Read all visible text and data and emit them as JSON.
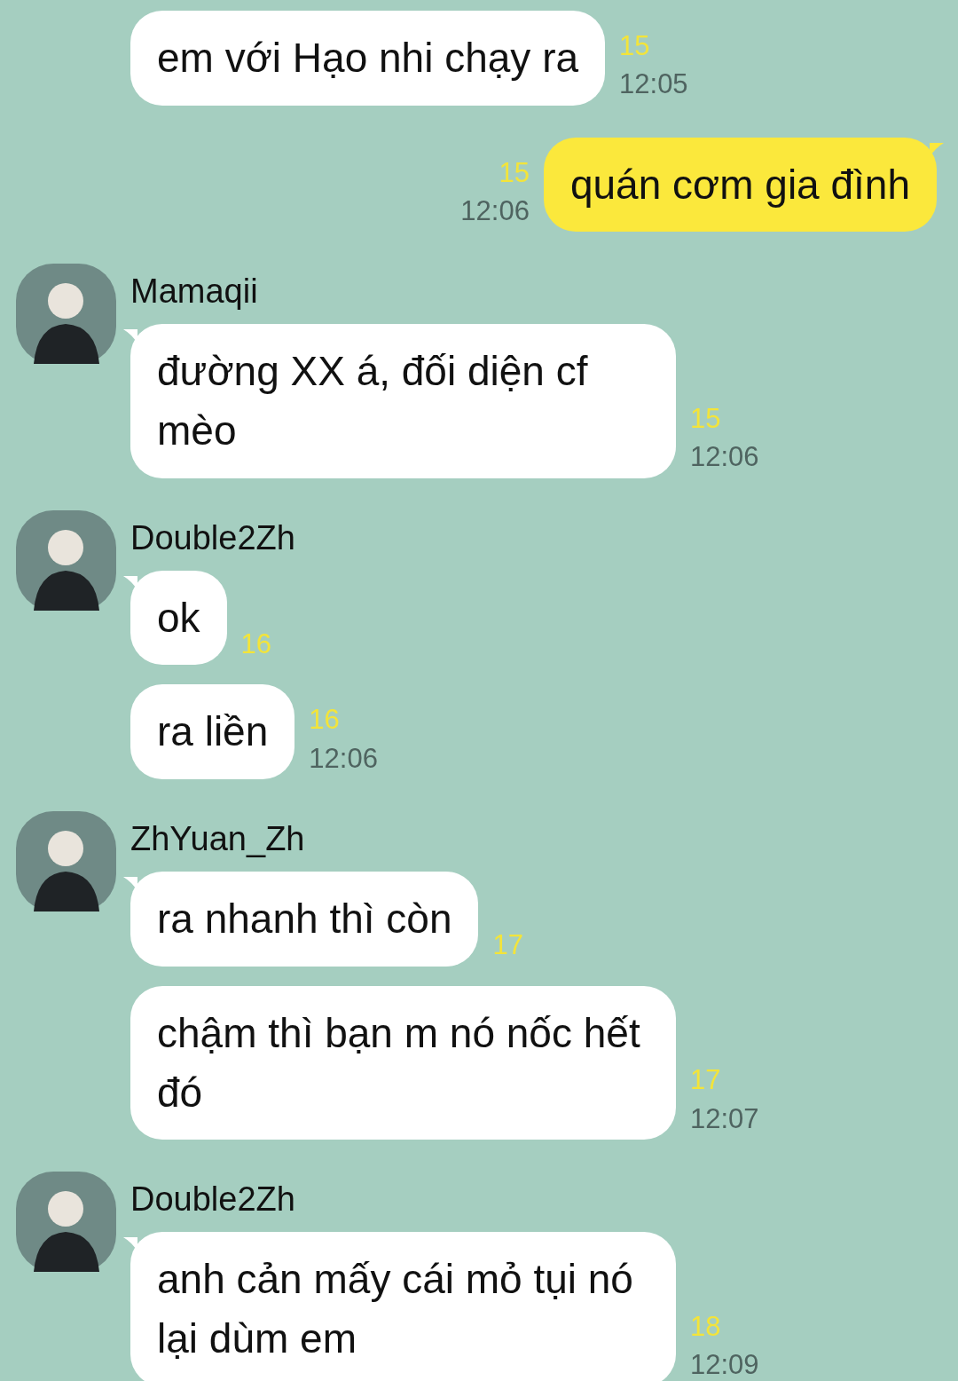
{
  "groups": [
    {
      "kind": "incoming",
      "messages": [
        {
          "text": "em với Hạo nhi chạy ra",
          "unread": "15",
          "time": "12:05"
        }
      ]
    },
    {
      "kind": "outgoing",
      "messages": [
        {
          "text": "quán cơm gia đình",
          "unread": "15",
          "time": "12:06"
        }
      ]
    },
    {
      "kind": "incoming",
      "sender": "Mamaqii",
      "messages": [
        {
          "text": "đường XX á, đối diện cf mèo",
          "unread": "15",
          "time": "12:06"
        }
      ]
    },
    {
      "kind": "incoming",
      "sender": "Double2Zh",
      "messages": [
        {
          "text": "ok",
          "unread": "16"
        },
        {
          "text": "ra liền",
          "unread": "16",
          "time": "12:06"
        }
      ]
    },
    {
      "kind": "incoming",
      "sender": "ZhYuan_Zh",
      "messages": [
        {
          "text": "ra nhanh thì còn",
          "unread": "17"
        },
        {
          "text": "chậm thì bạn m nó nốc hết đó",
          "unread": "17",
          "time": "12:07"
        }
      ]
    },
    {
      "kind": "incoming",
      "sender": "Double2Zh",
      "messages": [
        {
          "text": "anh cản mấy cái mỏ tụi nó lại dùm em",
          "unread": "18",
          "time": "12:09"
        }
      ]
    }
  ]
}
